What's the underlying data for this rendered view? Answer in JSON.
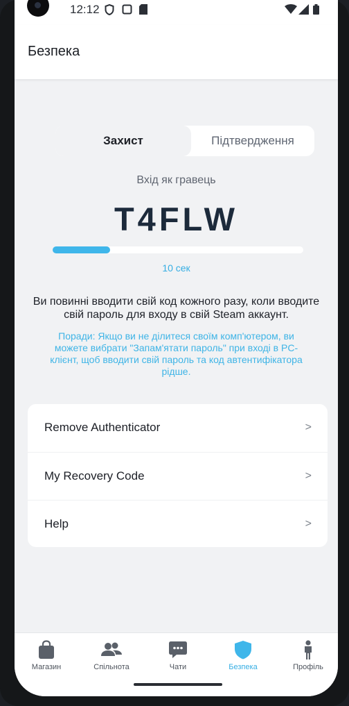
{
  "status_bar": {
    "time": "12:12"
  },
  "app_bar": {
    "title": "Безпека"
  },
  "segments": {
    "protection": "Захист",
    "confirmation": "Підтвердження"
  },
  "auth": {
    "login_label": "Вхід як гравець",
    "code": "T4FLW",
    "seconds_label": "10 сек",
    "progress_fraction": 0.23
  },
  "info_text": "Ви повинні вводити свій код кожного разу, коли вводите свій пароль для входу в свій Steam аккаунт.",
  "tips_text": "Поради: Якщо ви не ділитеся своїм комп'ютером, ви можете вибрати \"Запам'ятати пароль\" при вході в PC-клієнт, щоб вводити свій пароль та код автентифікатора рідше.",
  "menu": [
    {
      "label": "Remove Authenticator",
      "arrow": ">"
    },
    {
      "label": "My Recovery Code",
      "arrow": ">"
    },
    {
      "label": "Help",
      "arrow": ">"
    }
  ],
  "bottom_nav": {
    "items": [
      {
        "label": "Магазин",
        "icon": "shopping-bag-icon"
      },
      {
        "label": "Спільнота",
        "icon": "people-icon"
      },
      {
        "label": "Чати",
        "icon": "chat-bubble-icon"
      },
      {
        "label": "Безпека",
        "icon": "shield-icon",
        "active": true
      },
      {
        "label": "Профіль",
        "icon": "person-icon"
      }
    ]
  },
  "colors": {
    "accent": "#3fb6ea",
    "background": "#f1f2f4",
    "code_text": "#1c2a3b"
  }
}
